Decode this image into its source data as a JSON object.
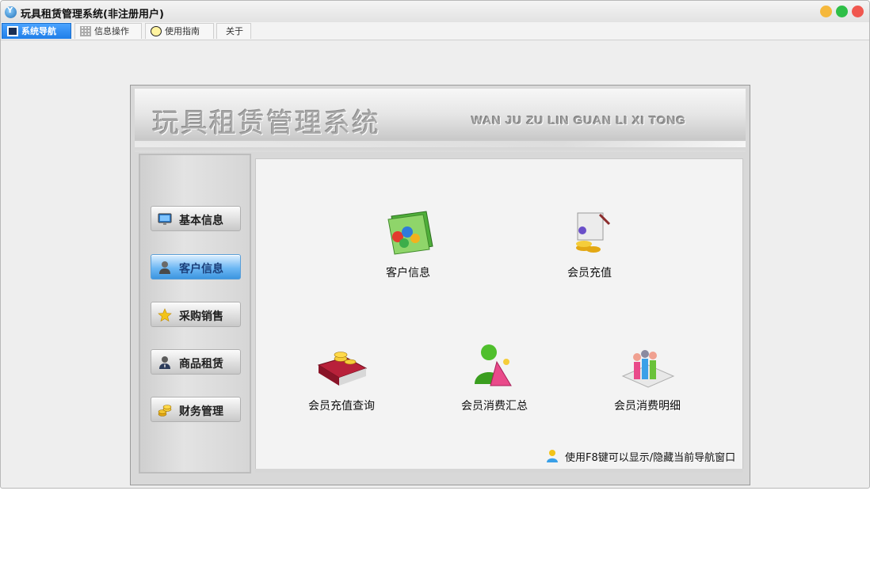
{
  "window": {
    "title": "玩具租赁管理系统(非注册用户)"
  },
  "tabs": [
    {
      "label": "系统导航",
      "icon": "monitor-icon",
      "active": true
    },
    {
      "label": "信息操作",
      "icon": "grid-icon",
      "active": false
    },
    {
      "label": "使用指南",
      "icon": "clock-icon",
      "active": false
    },
    {
      "label": "关于",
      "icon": "",
      "active": false
    }
  ],
  "banner": {
    "title": "玩具租赁管理系统",
    "subtitle": "WAN JU ZU LIN GUAN LI XI TONG"
  },
  "sidebar": {
    "items": [
      {
        "label": "基本信息",
        "icon": "monitor-icon",
        "active": false
      },
      {
        "label": "客户信息",
        "icon": "person-icon",
        "active": true
      },
      {
        "label": "采购销售",
        "icon": "star-icon",
        "active": false
      },
      {
        "label": "商品租赁",
        "icon": "businessman-icon",
        "active": false
      },
      {
        "label": "财务管理",
        "icon": "coins-icon",
        "active": false
      }
    ]
  },
  "functions": [
    {
      "label": "客户信息",
      "icon": "customer-folder-icon"
    },
    {
      "label": "会员充值",
      "icon": "recharge-icon"
    },
    {
      "label": "会员充值查询",
      "icon": "recharge-book-icon"
    },
    {
      "label": "会员消费汇总",
      "icon": "member-summary-icon"
    },
    {
      "label": "会员消费明细",
      "icon": "member-detail-icon"
    }
  ],
  "hint": {
    "text": "使用F8键可以显示/隐藏当前导航窗口",
    "icon": "user-hint-icon"
  },
  "colors": {
    "accent": "#1f7ee8",
    "active_nav": "#6eb8f4"
  }
}
